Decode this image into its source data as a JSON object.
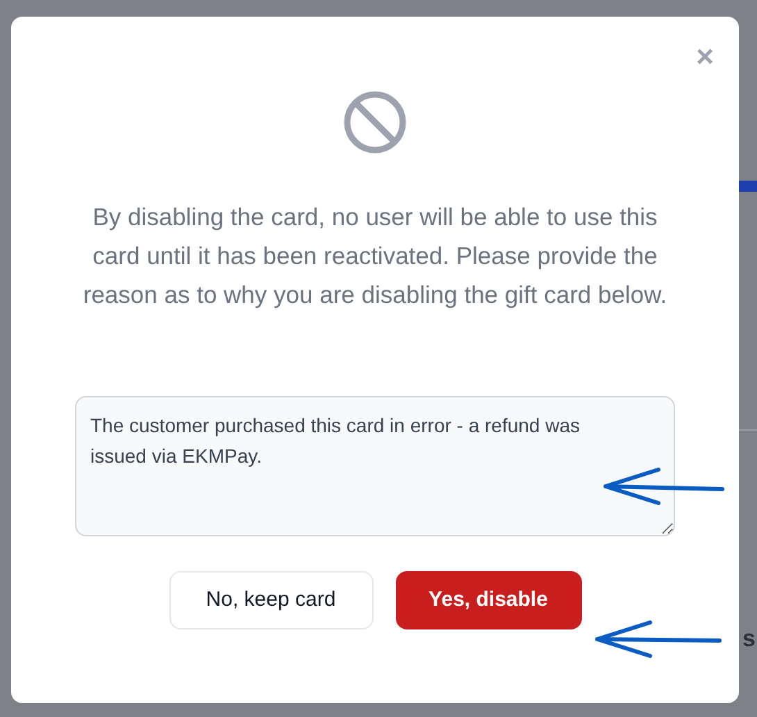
{
  "background": {
    "fragment_text": "s"
  },
  "dialog": {
    "close_icon": "×",
    "message": "By disabling the card, no user will be able to use this card until it has been reactivated. Please provide the reason as to why you are disabling the gift card below.",
    "reason": {
      "value": "The customer purchased this card in error - a refund was issued via EKMPay."
    },
    "buttons": [
      {
        "label": "No, keep card",
        "kind": "secondary"
      },
      {
        "label": "Yes, disable",
        "kind": "danger"
      }
    ]
  },
  "annotations": [
    {
      "kind": "arrow"
    },
    {
      "kind": "arrow"
    }
  ]
}
